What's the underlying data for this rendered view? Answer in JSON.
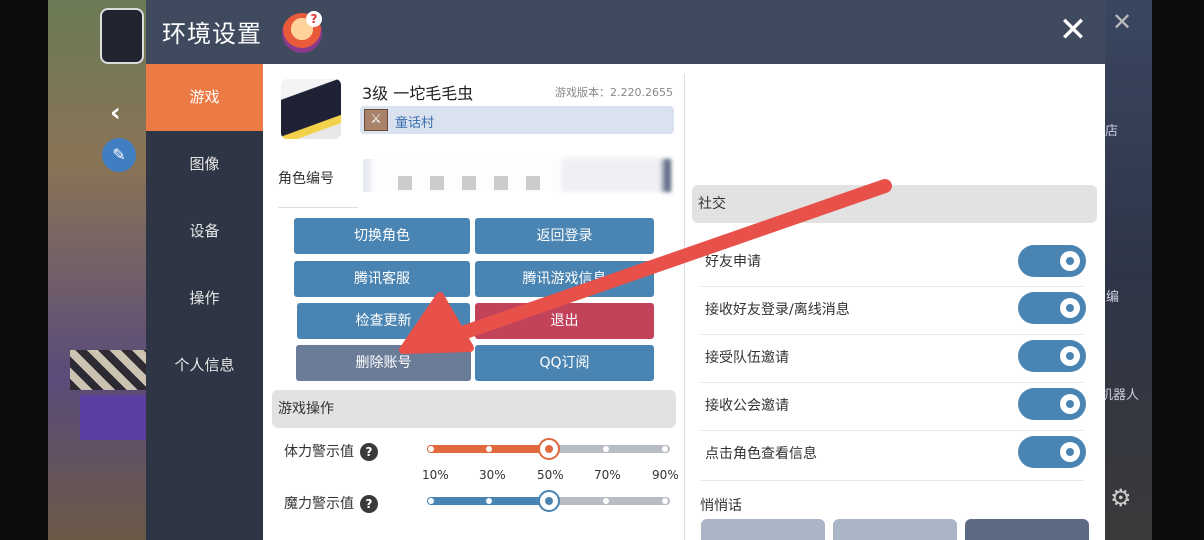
{
  "window": {
    "title": "环境设置",
    "close_glyph": "✕"
  },
  "sidebar": {
    "items": [
      {
        "label": "游戏",
        "active": true
      },
      {
        "label": "图像",
        "active": false
      },
      {
        "label": "设备",
        "active": false
      },
      {
        "label": "操作",
        "active": false
      },
      {
        "label": "个人信息",
        "active": false
      }
    ]
  },
  "profile": {
    "name": "3级 一坨毛毛虫",
    "version": "游戏版本：2.220.2655",
    "guild": "童话村",
    "char_id_label": "角色编号"
  },
  "buttons": {
    "switch_role": "切换角色",
    "return_login": "返回登录",
    "tencent_service": "腾讯客服",
    "tencent_game_info": "腾讯游戏信息",
    "check_update": "检查更新",
    "exit": "退出",
    "delete_account": "删除账号",
    "qq_subscribe": "QQ订阅"
  },
  "game_ops": {
    "header": "游戏操作",
    "hp_label": "体力警示值",
    "mp_label": "魔力警示值",
    "hp_value_percent": 50,
    "mp_value_percent": 50,
    "ticks": [
      "10%",
      "30%",
      "50%",
      "70%",
      "90%"
    ]
  },
  "social": {
    "header": "社交",
    "items": [
      {
        "label": "好友申请",
        "on": true
      },
      {
        "label": "接收好友登录/离线消息",
        "on": true
      },
      {
        "label": "接受队伍邀请",
        "on": true
      },
      {
        "label": "接收公会邀请",
        "on": true
      },
      {
        "label": "点击角色查看信息",
        "on": true
      }
    ],
    "whisper_header": "悄悄话"
  },
  "background": {
    "right_labels": [
      "店",
      "编",
      "机器人"
    ]
  },
  "colors": {
    "accent": "#ec7a45",
    "primary_button": "#4a84b2",
    "danger_button": "#c2425a",
    "annotation_arrow": "#e8504a"
  }
}
